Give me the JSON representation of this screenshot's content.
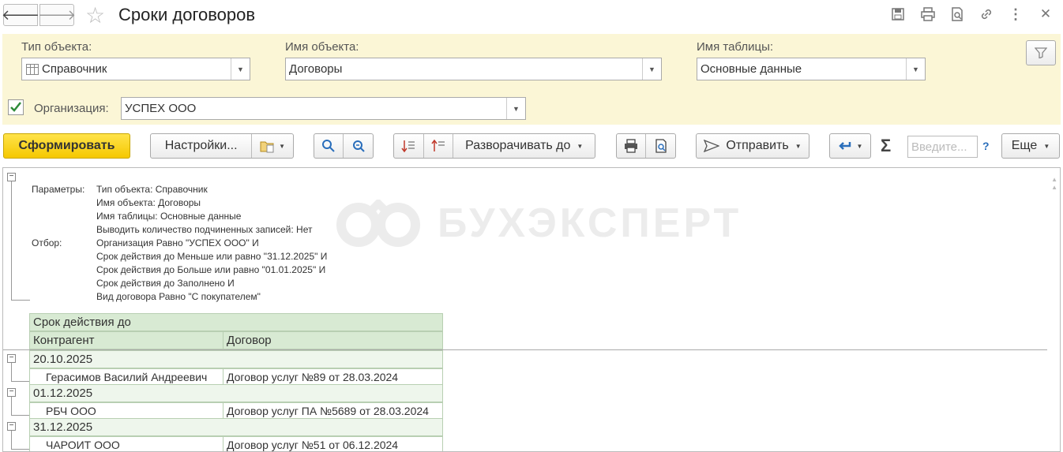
{
  "window": {
    "title": "Сроки договоров",
    "back_icon": "arrow-left-icon",
    "forward_icon": "arrow-right-icon",
    "favorite_icon": "star-icon",
    "tools": [
      "save-icon",
      "print-icon",
      "preview-icon",
      "link-icon",
      "more-icon",
      "close-icon"
    ]
  },
  "filters": {
    "object_type": {
      "label": "Тип объекта:",
      "value": "Справочник"
    },
    "object_name": {
      "label": "Имя объекта:",
      "value": "Договоры"
    },
    "table_name": {
      "label": "Имя таблицы:",
      "value": "Основные данные"
    },
    "organization": {
      "label": "Организация:",
      "value": "УСПЕХ ООО",
      "checked": true
    }
  },
  "toolbar": {
    "generate": "Сформировать",
    "settings": "Настройки...",
    "expand_to": "Разворачивать до",
    "send": "Отправить",
    "search_placeholder": "Введите...",
    "help": "?",
    "more": "Еще"
  },
  "report": {
    "watermark": "БУХЭКСПЕРТ",
    "params_label": "Параметры:",
    "params": [
      "Тип объекта: Справочник",
      "Имя объекта: Договоры",
      "Имя таблицы: Основные данные",
      "Выводить количество подчиненных записей: Нет"
    ],
    "filter_label": "Отбор:",
    "filter_lines": [
      "Организация Равно \"УСПЕХ ООО\" И",
      "Срок действия до Меньше или равно \"31.12.2025\" И",
      "Срок действия до Больше или равно \"01.01.2025\" И",
      "Срок действия до Заполнено И",
      "Вид договора Равно \"С покупателем\""
    ],
    "header_group": "Срок действия до",
    "col1": "Контрагент",
    "col2": "Договор",
    "groups": [
      {
        "date": "20.10.2025",
        "contractor": "Герасимов Василий Андреевич",
        "contract": "Договор услуг №89 от 28.03.2024"
      },
      {
        "date": "01.12.2025",
        "contractor": "РБЧ ООО",
        "contract": "Договор услуг ПА №5689 от 28.03.2024"
      },
      {
        "date": "31.12.2025",
        "contractor": "ЧАРОИТ ООО",
        "contract": "Договор услуг №51 от 06.12.2024"
      }
    ]
  }
}
